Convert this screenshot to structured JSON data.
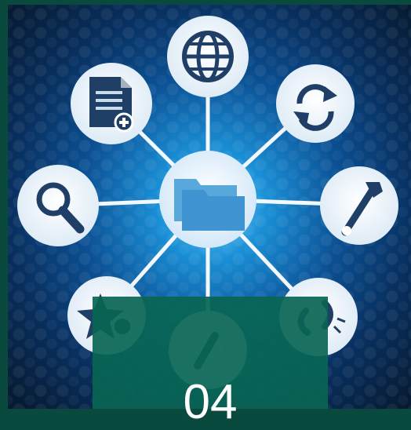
{
  "slide": {
    "number": "04"
  },
  "hub": {
    "center_icon": "folder-icon",
    "nodes": [
      {
        "icon": "globe-icon"
      },
      {
        "icon": "refresh-icon"
      },
      {
        "icon": "wrench-icon"
      },
      {
        "icon": "broken-link-icon"
      },
      {
        "icon": "link-icon"
      },
      {
        "icon": "star-add-icon"
      },
      {
        "icon": "search-icon"
      },
      {
        "icon": "document-add-icon"
      }
    ]
  },
  "colors": {
    "background_teal": "#0a4a3e",
    "overlay_teal": "#096554",
    "glow_blue": "#1a8fd6",
    "icon_blue": "#1f5f96"
  }
}
